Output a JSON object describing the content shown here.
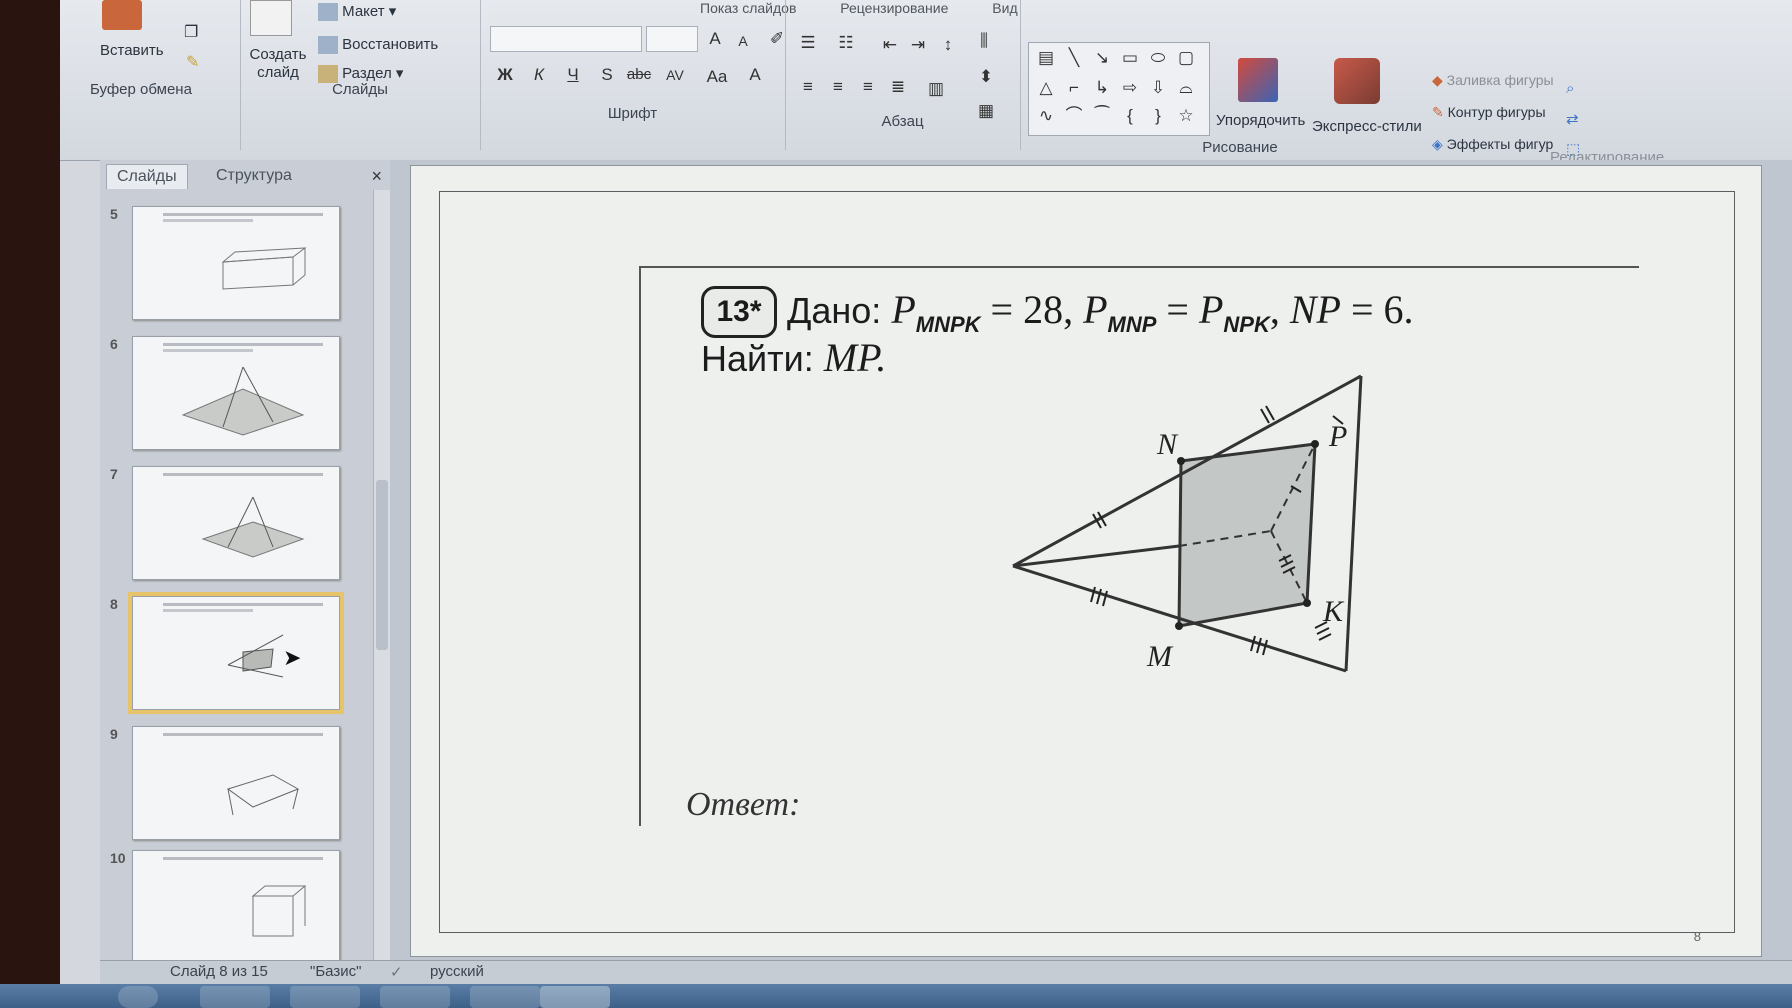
{
  "ribbon": {
    "tabs": [
      "Показ слайдов",
      "Рецензирование",
      "Вид"
    ],
    "clipboard": {
      "paste_label": "Вставить",
      "group_label": "Буфер обмена"
    },
    "slides": {
      "create_label": "Создать слайд",
      "layout_label": "Макет",
      "restore_label": "Восстановить",
      "section_label": "Раздел",
      "group_label": "Слайды"
    },
    "font": {
      "group_label": "Шрифт",
      "bold": "Ж",
      "italic": "К",
      "underline": "Ч",
      "shadow": "S",
      "strike": "abc",
      "spacing": "AV",
      "case": "Aa",
      "color": "A"
    },
    "paragraph": {
      "group_label": "Абзац"
    },
    "drawing": {
      "arrange_label": "Упорядочить",
      "styles_label": "Экспресс-стили",
      "fill_label": "Заливка фигуры",
      "outline_label": "Контур фигуры",
      "effects_label": "Эффекты фигур",
      "group_label": "Рисование"
    },
    "editing": {
      "group_label": "Редактирование"
    }
  },
  "panel": {
    "tab_slides": "Слайды",
    "tab_outline": "Структура",
    "close": "×",
    "thumbs": [
      {
        "num": "5"
      },
      {
        "num": "6"
      },
      {
        "num": "7"
      },
      {
        "num": "8"
      },
      {
        "num": "9"
      },
      {
        "num": "10"
      }
    ]
  },
  "slide": {
    "badge": "13*",
    "given_label": "Дано:",
    "find_label": "Найти:",
    "find_value": "MP.",
    "answer_label": "Ответ:",
    "slide_number": "8",
    "points": [
      "N",
      "P",
      "K",
      "M"
    ]
  },
  "status": {
    "slide_info": "Слайд 8 из 15",
    "theme": "\"Базис\"",
    "language": "русский"
  }
}
